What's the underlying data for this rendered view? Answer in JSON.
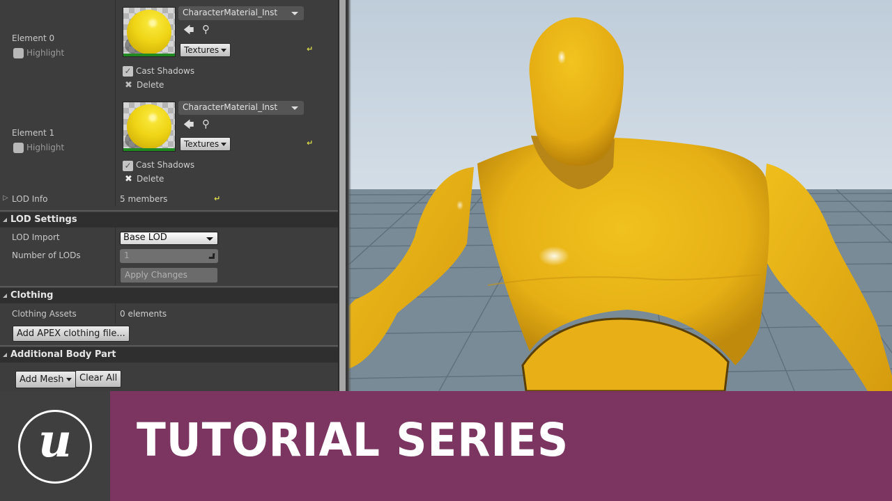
{
  "details": {
    "elements": [
      {
        "label": "Element 0",
        "highlight_label": "Highlight",
        "material": "CharacterMaterial_Inst",
        "textures_label": "Textures",
        "cast_shadows_label": "Cast Shadows",
        "cast_shadows_checked": true,
        "delete_label": "Delete",
        "icons": {
          "browse": "arrow-left-icon",
          "find": "search-icon",
          "reset": "reset-to-default-icon"
        }
      },
      {
        "label": "Element 1",
        "highlight_label": "Highlight",
        "material": "CharacterMaterial_Inst",
        "textures_label": "Textures",
        "cast_shadows_label": "Cast Shadows",
        "cast_shadows_checked": true,
        "delete_label": "Delete",
        "icons": {
          "browse": "arrow-left-icon",
          "find": "search-icon",
          "reset": "reset-to-default-icon"
        }
      }
    ],
    "lod_info": {
      "label": "LOD Info",
      "value": "5 members"
    },
    "sections": {
      "lod_settings": {
        "title": "LOD Settings",
        "lod_import_label": "LOD Import",
        "lod_import_value": "Base LOD",
        "num_lods_label": "Number of LODs",
        "num_lods_value": "1",
        "apply_label": "Apply Changes"
      },
      "clothing": {
        "title": "Clothing",
        "assets_label": "Clothing Assets",
        "assets_value": "0 elements",
        "add_button": "Add APEX clothing file..."
      },
      "additional_body_part": {
        "title": "Additional Body Part",
        "add_mesh": "Add Mesh",
        "clear_all": "Clear All"
      }
    }
  },
  "viewport": {
    "subject": "mannequin-character",
    "material_color": "#e9b217"
  },
  "banner": {
    "title": "TUTORIAL SERIES",
    "logo": "unreal-engine-logo",
    "logo_glyph": "u",
    "accent_color": "#7b3560"
  }
}
